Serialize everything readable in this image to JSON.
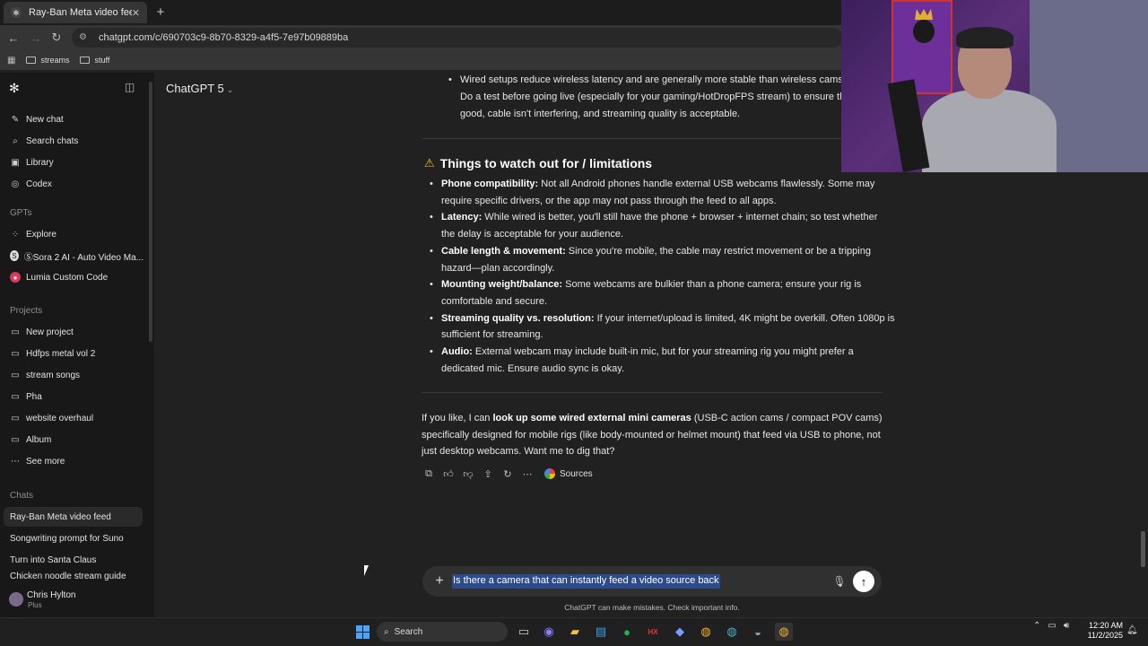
{
  "browser": {
    "tab_title": "Ray-Ban Meta video feed",
    "url": "chatgpt.com/c/690703c9-8b70-8329-a4f5-7e97b09889ba",
    "bookmarks": [
      "streams",
      "stuff"
    ]
  },
  "sidebar": {
    "nav": [
      {
        "label": "New chat",
        "icon": "pencil-icon"
      },
      {
        "label": "Search chats",
        "icon": "search-icon"
      },
      {
        "label": "Library",
        "icon": "library-icon"
      },
      {
        "label": "Codex",
        "icon": "codex-icon"
      }
    ],
    "gpts_label": "GPTs",
    "gpts": [
      {
        "label": "Explore",
        "icon": "grid-icon"
      },
      {
        "label": "ⓈSora 2 AI - Auto Video Ma...",
        "icon": "sora-icon"
      },
      {
        "label": "Lumia Custom Code",
        "icon": "lumia-icon"
      }
    ],
    "projects_label": "Projects",
    "projects": [
      {
        "label": "New project",
        "icon": "folder-plus-icon"
      },
      {
        "label": "Hdfps metal vol 2",
        "icon": "folder-icon"
      },
      {
        "label": "stream songs",
        "icon": "folder-icon"
      },
      {
        "label": "Pha",
        "icon": "folder-icon"
      },
      {
        "label": "website overhaul",
        "icon": "folder-icon"
      },
      {
        "label": "Album",
        "icon": "folder-icon"
      },
      {
        "label": "See more",
        "icon": "ellipsis-icon"
      }
    ],
    "chats_label": "Chats",
    "chats": [
      "Ray-Ban Meta video feed",
      "Songwriting prompt for Suno",
      "Turn into Santa Claus",
      "Chicken noodle stream guide"
    ],
    "user": {
      "name": "Chris Hylton",
      "plan": "Plus"
    }
  },
  "header": {
    "model": "ChatGPT 5"
  },
  "content": {
    "top_bullets": [
      "Wired setups reduce wireless latency and are generally more stable than wireless cams.",
      "Do a test before going live (especially for your gaming/HotDropFPS stream) to ensure the",
      "good, cable isn't interfering, and streaming quality is acceptable."
    ],
    "warning_heading": "Things to watch out for / limitations",
    "limitations": [
      {
        "title": "Phone compatibility:",
        "line1": " Not all Android phones handle external USB webcams flawlessly. Some may",
        "line2": "require specific drivers, or the app may not pass through the feed to all apps."
      },
      {
        "title": "Latency:",
        "line1": " While wired is better, you'll still have the phone + browser + internet chain; so test whether",
        "line2": "the delay is acceptable for your audience."
      },
      {
        "title": "Cable length & movement:",
        "line1": " Since you're mobile, the cable may restrict movement or be a tripping",
        "line2": "hazard—plan accordingly."
      },
      {
        "title": "Mounting weight/balance:",
        "line1": " Some webcams are bulkier than a phone camera; ensure your rig is",
        "line2": "comfortable and secure."
      },
      {
        "title": "Streaming quality vs. resolution:",
        "line1": " If your internet/upload is limited, 4K might be overkill. Often 1080p is",
        "line2": "sufficient for streaming."
      },
      {
        "title": "Audio:",
        "line1": " External webcam may include built-in mic, but for your streaming rig you might prefer a",
        "line2": "dedicated mic. Ensure audio sync is okay."
      }
    ],
    "closing": {
      "pre": "If you like, I can ",
      "bold": "look up some wired external mini cameras",
      "post1": " (USB-C action cams / compact POV cams)",
      "line2": "specifically designed for mobile rigs (like body-mounted or helmet mount) that feed via USB to phone, not",
      "line3": "just desktop webcams. Want me to dig that?"
    },
    "sources_label": "Sources"
  },
  "composer": {
    "value": "Is there a camera that can instantly feed a video source back",
    "disclaimer": "ChatGPT can make mistakes. Check important info."
  },
  "taskbar": {
    "search": "Search",
    "time": "12:20 AM",
    "date": "11/2/2025"
  }
}
